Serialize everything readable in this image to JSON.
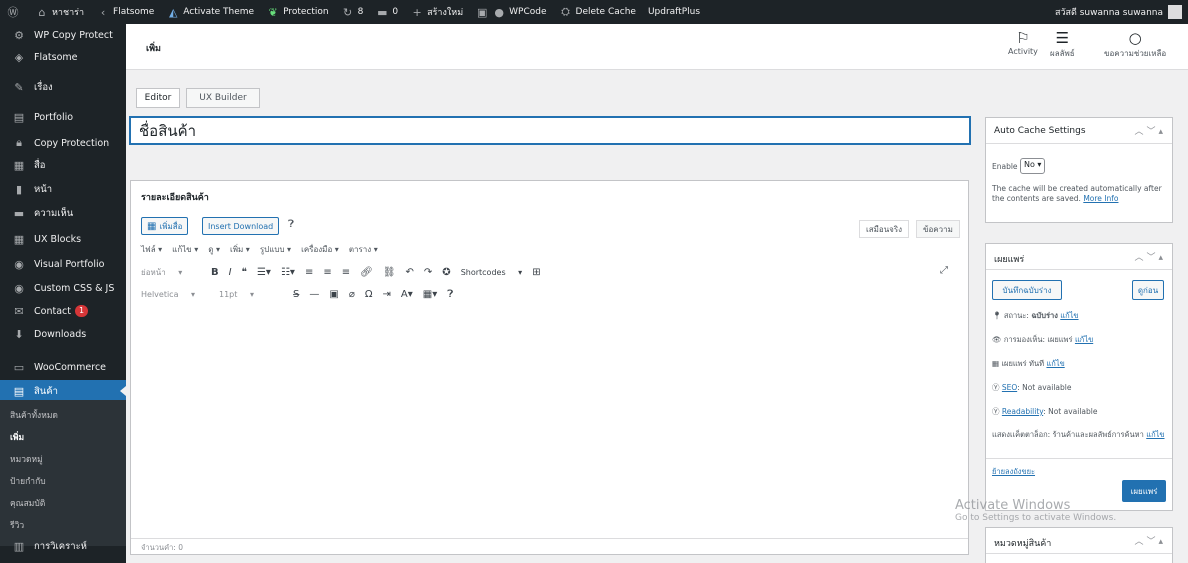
{
  "adminbar": {
    "site_name": "หาชาร่า",
    "site_switch": "Flatsome",
    "activate_theme": "Activate Theme",
    "protection": "Protection",
    "updates_count": "8",
    "comments_count": "0",
    "new_label": "สร้างใหม่",
    "wpcode": "WPCode",
    "delete_cache": "Delete Cache",
    "updraftplus": "UpdraftPlus",
    "user_name": "สวัสดี suwanna suwanna"
  },
  "sidebar": {
    "items": [
      {
        "label": "WP Copy Protect",
        "icon": "gear-icon"
      },
      {
        "label": "Flatsome",
        "icon": "diamond-icon"
      },
      {
        "label": "เรื่อง",
        "icon": "pin-icon"
      },
      {
        "label": "Portfolio",
        "icon": "portfolio-icon"
      },
      {
        "label": "Copy Protection",
        "icon": "lock-icon"
      },
      {
        "label": "สื่อ",
        "icon": "media-icon"
      },
      {
        "label": "หน้า",
        "icon": "page-icon"
      },
      {
        "label": "ความเห็น",
        "icon": "comment-icon"
      },
      {
        "label": "UX Blocks",
        "icon": "blocks-icon"
      },
      {
        "label": "Visual Portfolio",
        "icon": "visual-portfolio-icon"
      },
      {
        "label": "Custom CSS & JS",
        "icon": "code-icon"
      },
      {
        "label": "Contact",
        "icon": "mail-icon",
        "badge": "1"
      },
      {
        "label": "Downloads",
        "icon": "download-icon"
      },
      {
        "label": "WooCommerce",
        "icon": "woocommerce-icon"
      },
      {
        "label": "สินค้า",
        "icon": "product-icon"
      }
    ],
    "submenu": [
      "สินค้าทั้งหมด",
      "เพิ่ม",
      "หมวดหมู่",
      "ป้ายกำกับ",
      "คุณสมบัติ",
      "รีวิว"
    ],
    "bottom_item": "การวิเคราะห์"
  },
  "page_header": {
    "title": "เพิ่ม",
    "tools": [
      {
        "label": "Activity",
        "icon": "flag-icon"
      },
      {
        "label": "ผลลัพธ์",
        "icon": "document-icon"
      },
      {
        "label": "ขอความช่วยเหลือ",
        "icon": "help-circle-icon"
      }
    ]
  },
  "editor_tabs": {
    "editor": "Editor",
    "ux_builder": "UX Builder"
  },
  "title_input": {
    "value": "ชื่อสินค้า"
  },
  "description_box": {
    "title": "รายละเอียดสินค้า",
    "add_media": "เพิ่มสื่อ",
    "insert_download": "Insert Download",
    "visual_tab": "เสมือนจริง",
    "text_tab": "ข้อความ",
    "menubar": [
      "ไฟล์ ▾",
      "แก้ไข ▾",
      "ดู ▾",
      "เพิ่ม ▾",
      "รูปแบบ ▾",
      "เครื่องมือ ▾",
      "ตาราง ▾"
    ],
    "format_select": "ย่อหน้า",
    "shortcodes": "Shortcodes",
    "font_family": "Helvetica",
    "font_size": "11pt",
    "word_count": "จำนวนคำ: 0"
  },
  "cache_box": {
    "title": "Auto Cache Settings",
    "enable_label": "Enable",
    "enable_value": "No",
    "description": "The cache will be created automatically after the contents are saved.",
    "more_info": "More Info"
  },
  "publish_box": {
    "title": "เผยแพร่",
    "save_draft": "บันทึกฉบับร่าง",
    "preview": "ดูก่อน",
    "status_label": "สถานะ:",
    "status_value": "ฉบับร่าง",
    "visibility_label": "การมองเห็น:",
    "visibility_value": "เผยแพร่",
    "publish_time": "เผยแพร่ ทันที",
    "edit_link": "แก้ไข",
    "seo": "SEO",
    "seo_value": ": Not available",
    "readability": "Readability",
    "readability_value": ": Not available",
    "catalog_visibility": "แสดงเเค็ตตาล็อก: ร้านค้าและผลลัพธ์การค้นหา",
    "move_to_trash": "ย้ายลงถังขยะ",
    "publish_button": "เผยแพร่"
  },
  "category_box": {
    "title": "หมวดหมู่สินค้า"
  },
  "watermark": {
    "line1": "Activate Windows",
    "line2": "Go to Settings to activate Windows."
  }
}
